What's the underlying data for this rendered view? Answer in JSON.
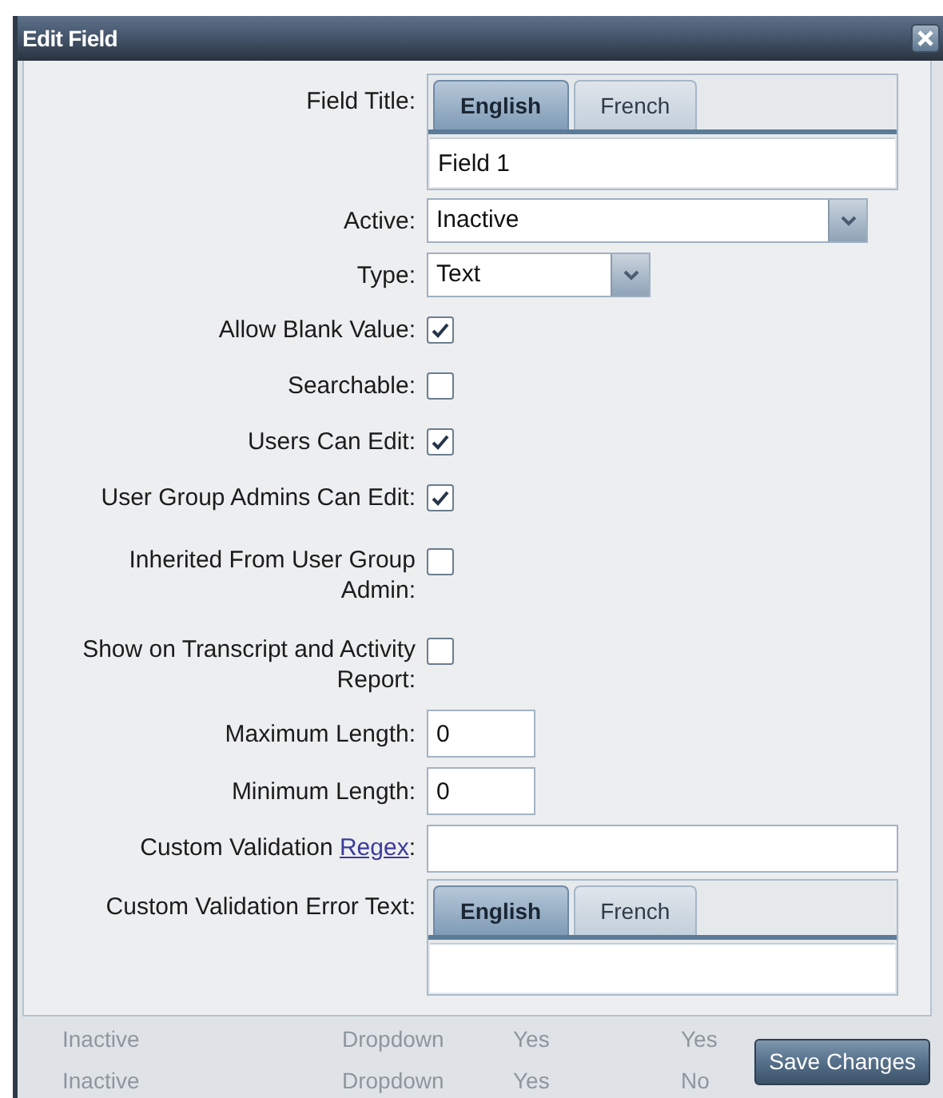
{
  "dialog": {
    "title": "Edit Field"
  },
  "fields": [
    {
      "kind": "tabs-text",
      "label": "Field Title:",
      "tabs": [
        {
          "label": "English",
          "selected": true
        },
        {
          "label": "French",
          "selected": false
        }
      ],
      "value": "Field 1"
    },
    {
      "kind": "select-wide",
      "label": "Active:",
      "value": "Inactive"
    },
    {
      "kind": "select-short",
      "label": "Type:",
      "value": "Text"
    },
    {
      "kind": "checkbox",
      "label": "Allow Blank Value:",
      "checked": true
    },
    {
      "kind": "checkbox",
      "label": "Searchable:",
      "checked": false
    },
    {
      "kind": "checkbox",
      "label": "Users Can Edit:",
      "checked": true
    },
    {
      "kind": "checkbox",
      "label": "User Group Admins Can Edit:",
      "checked": true
    },
    {
      "kind": "checkbox",
      "label": "Inherited From User Group Admin:",
      "checked": false
    },
    {
      "kind": "checkbox",
      "label": "Show on Transcript and Activity Report:",
      "checked": false
    },
    {
      "kind": "input-short",
      "label": "Maximum Length:",
      "value": "0"
    },
    {
      "kind": "input-short",
      "label": "Minimum Length:",
      "value": "0"
    },
    {
      "kind": "input-wide",
      "label": "Custom Validation",
      "link": "Regex",
      "suffix": ":"
    },
    {
      "kind": "tabs-text",
      "label": "Custom Validation Error Text:",
      "tabs": [
        {
          "label": "English",
          "selected": true
        },
        {
          "label": "French",
          "selected": false
        }
      ]
    }
  ],
  "background_rows": [
    [
      "Inactive",
      "Dropdown",
      "Yes",
      "Yes"
    ],
    [
      "Inactive",
      "Dropdown",
      "Yes",
      "No"
    ]
  ],
  "footer": {
    "button": "Save Changes"
  }
}
